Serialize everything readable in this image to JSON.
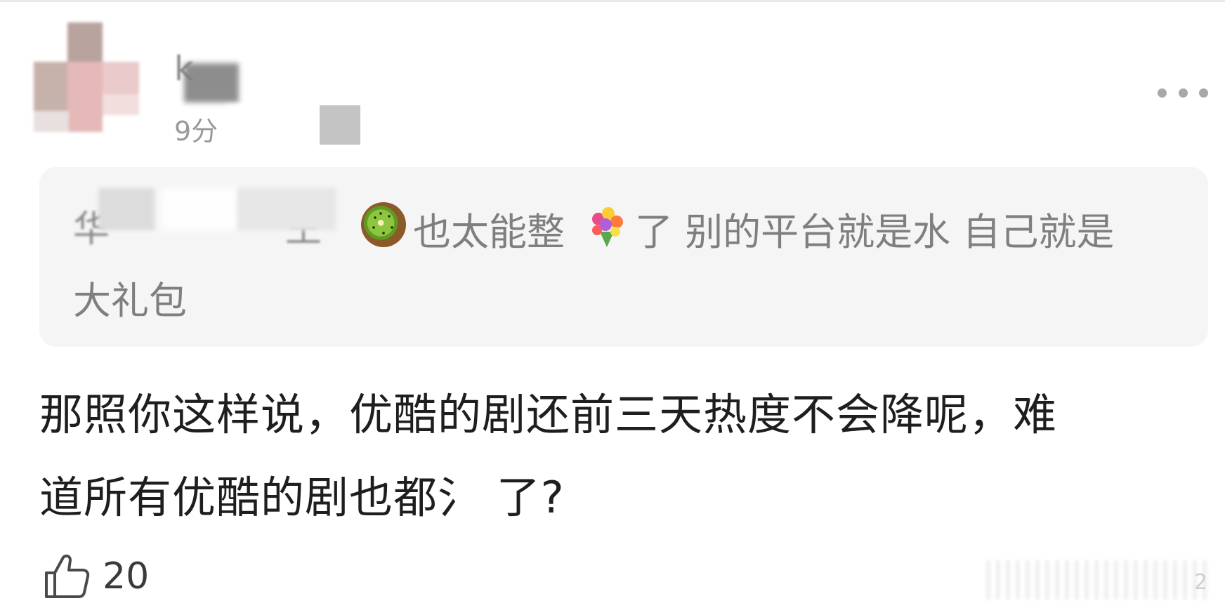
{
  "comment": {
    "author": {
      "name_visible": "k",
      "time": "9分",
      "more_label": "更多"
    },
    "quote": {
      "name_visible_1": "华",
      "name_visible_2": "王",
      "text_part1": "也太能整",
      "text_part2": "了 别的平台就是水 自己就是",
      "text_line2": "大礼包",
      "emojis": [
        "kiwi-icon",
        "bouquet-icon"
      ]
    },
    "body": {
      "line1": "那照你这样说，优酷的剧还前三天热度不会降呢，难",
      "line2": "道所有优酷的剧也都氵 了?"
    },
    "likes": {
      "count": "20"
    },
    "watermark_char": "2"
  },
  "colors": {
    "quote_bg": "#f5f5f5",
    "text_primary": "#1e1e1e",
    "text_secondary": "#7f7f7f"
  }
}
